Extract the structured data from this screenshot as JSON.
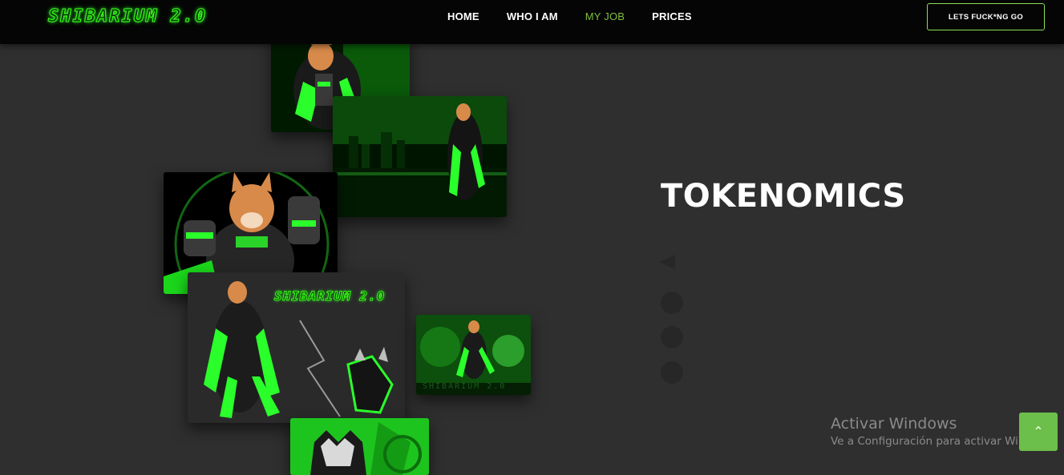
{
  "brand": {
    "logo_text": "SHIBARIUM 2.0"
  },
  "nav": {
    "items": [
      {
        "label": "HOME",
        "active": false
      },
      {
        "label": "WHO I AM",
        "active": false
      },
      {
        "label": "MY JOB",
        "active": true
      },
      {
        "label": "PRICES",
        "active": false
      }
    ],
    "cta_label": "LETS FUCK*NG GO"
  },
  "main": {
    "title": "TOKENOMICS"
  },
  "gallery": {
    "banner_text": "SHIBARIUM 2.0",
    "small_caption": "SHIBARIUM 2.0"
  },
  "os_watermark": {
    "title": "Activar Windows",
    "subtitle": "Ve a Configuración para activar Windows."
  },
  "scroll_top": {
    "icon": "chevron-up-icon"
  },
  "colors": {
    "accent_green": "#39ff14",
    "active_nav": "#7fbf3f",
    "scroll_button": "#6cbf4a",
    "background": "#2f2f2f"
  }
}
